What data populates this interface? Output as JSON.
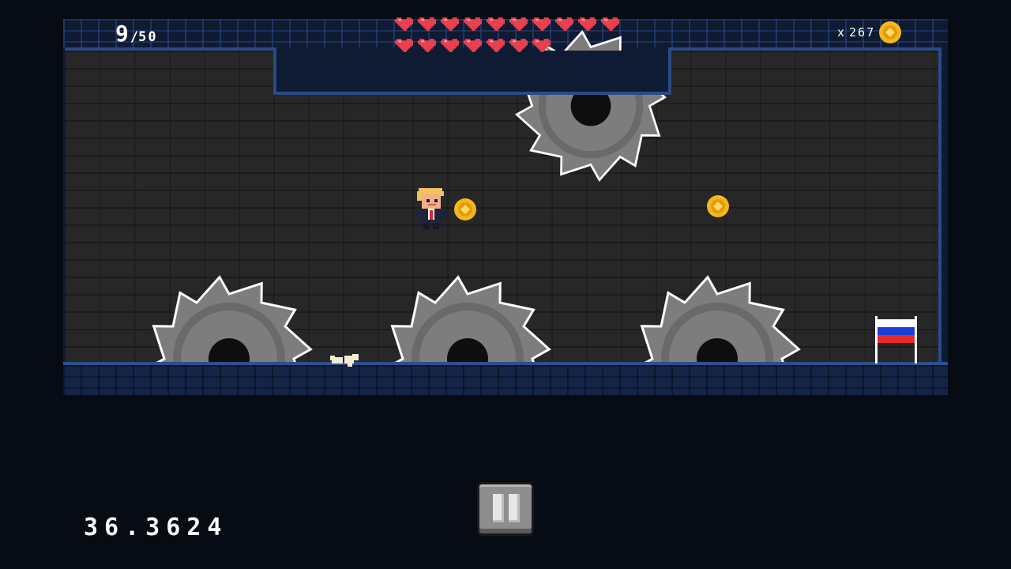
{
  "hud": {
    "level_current": "9",
    "level_total": "50",
    "level_separator": "/",
    "hearts_total": 17,
    "coin_multiplier": "x",
    "coin_count": "267",
    "timer": "36.3624"
  },
  "icons": {
    "heart": "heart-icon",
    "coin": "coin-icon",
    "pause": "pause-icon"
  },
  "colors": {
    "heart": "#e8404f",
    "coin": "#f5b81c",
    "wall": "#0f1a33",
    "wall_edge": "#2b4a86",
    "room": "#272727",
    "saw": "#7d7d7d",
    "flag_white": "#ffffff",
    "flag_blue": "#1c3ed6",
    "flag_red": "#e52a2a"
  }
}
